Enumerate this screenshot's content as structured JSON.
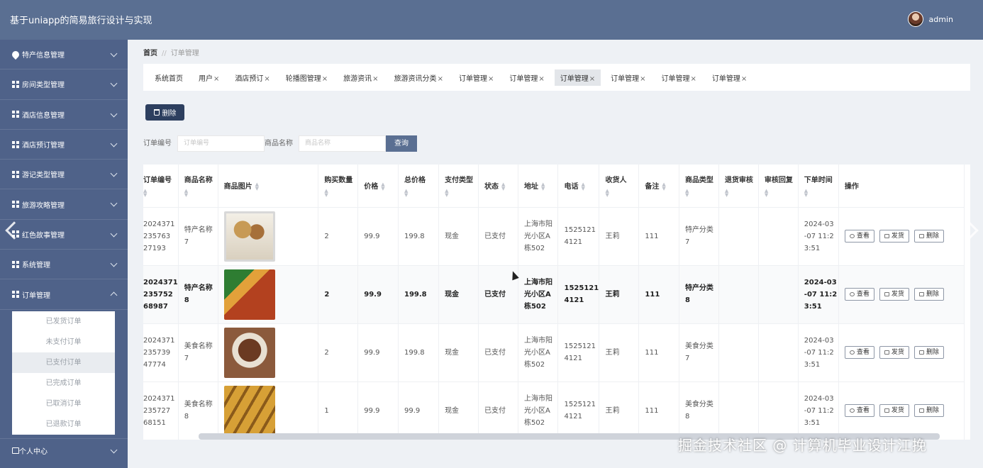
{
  "header": {
    "app_title": "基于uniapp的简易旅行设计与实现",
    "username": "admin"
  },
  "sidebar": {
    "items": [
      {
        "label": "特产信息管理",
        "icon": "pin-icon"
      },
      {
        "label": "房间类型管理",
        "icon": "grid-icon"
      },
      {
        "label": "酒店信息管理",
        "icon": "grid-icon"
      },
      {
        "label": "酒店预订管理",
        "icon": "grid-icon"
      },
      {
        "label": "游记类型管理",
        "icon": "grid-icon"
      },
      {
        "label": "旅游攻略管理",
        "icon": "grid-icon"
      },
      {
        "label": "红色故事管理",
        "icon": "grid-icon"
      },
      {
        "label": "系统管理",
        "icon": "grid-icon"
      },
      {
        "label": "订单管理",
        "icon": "grid-icon"
      }
    ],
    "submenu": [
      "已发货订单",
      "未支付订单",
      "已支付订单",
      "已完成订单",
      "已取消订单",
      "已退款订单"
    ],
    "bottom_item": "个人中心"
  },
  "breadcrumb": {
    "home": "首页",
    "separator": "//",
    "current": "订单管理"
  },
  "tabs": [
    {
      "label": "系统首页",
      "closable": false
    },
    {
      "label": "用户",
      "closable": true
    },
    {
      "label": "酒店预订",
      "closable": true
    },
    {
      "label": "轮播图管理",
      "closable": true
    },
    {
      "label": "旅游资讯",
      "closable": true
    },
    {
      "label": "旅游资讯分类",
      "closable": true
    },
    {
      "label": "订单管理",
      "closable": true
    },
    {
      "label": "订单管理",
      "closable": true
    },
    {
      "label": "订单管理",
      "closable": true,
      "active": true
    },
    {
      "label": "订单管理",
      "closable": true
    },
    {
      "label": "订单管理",
      "closable": true
    },
    {
      "label": "订单管理",
      "closable": true
    }
  ],
  "toolbar": {
    "delete_label": "删除"
  },
  "filters": {
    "order_no_label": "订单编号",
    "order_no_placeholder": "订单编号",
    "product_label": "商品名称",
    "product_placeholder": "商品名称",
    "query_label": "查询"
  },
  "table": {
    "columns": [
      "订单编号",
      "商品名称",
      "商品图片",
      "购买数量",
      "价格",
      "总价格",
      "支付类型",
      "状态",
      "地址",
      "电话",
      "收货人",
      "备注",
      "商品类型",
      "退货审核",
      "审核回复",
      "下单时间",
      "操作"
    ],
    "rows": [
      {
        "order_no": [
          "2024371",
          "235763",
          "27193"
        ],
        "name": [
          "特产名称",
          "7"
        ],
        "qty": "2",
        "price": "99.9",
        "total": "199.8",
        "pay": "现金",
        "status": "已支付",
        "addr": [
          "上海市阳",
          "光小区A",
          "栋502"
        ],
        "phone": [
          "1525121",
          "4121"
        ],
        "receiver": "王莉",
        "remark": "111",
        "type": [
          "特产分类",
          "7"
        ],
        "time": [
          "2024-03",
          "-07 11:2",
          "3:51"
        ]
      },
      {
        "order_no": [
          "2024371",
          "235752",
          "68987"
        ],
        "name": [
          "特产名称",
          "8"
        ],
        "qty": "2",
        "price": "99.9",
        "total": "199.8",
        "pay": "现金",
        "status": "已支付",
        "addr": [
          "上海市阳",
          "光小区A",
          "栋502"
        ],
        "phone": [
          "1525121",
          "4121"
        ],
        "receiver": "王莉",
        "remark": "111",
        "type": [
          "特产分类",
          "8"
        ],
        "time": [
          "2024-03",
          "-07 11:2",
          "3:51"
        ]
      },
      {
        "order_no": [
          "2024371",
          "235739",
          "47774"
        ],
        "name": [
          "美食名称",
          "7"
        ],
        "qty": "2",
        "price": "99.9",
        "total": "199.8",
        "pay": "现金",
        "status": "已支付",
        "addr": [
          "上海市阳",
          "光小区A",
          "栋502"
        ],
        "phone": [
          "1525121",
          "4121"
        ],
        "receiver": "王莉",
        "remark": "111",
        "type": [
          "美食分类",
          "7"
        ],
        "time": [
          "2024-03",
          "-07 11:2",
          "3:51"
        ]
      },
      {
        "order_no": [
          "2024371",
          "235727",
          "68151"
        ],
        "name": [
          "美食名称",
          "8"
        ],
        "qty": "1",
        "price": "99.9",
        "total": "99.9",
        "pay": "现金",
        "status": "已支付",
        "addr": [
          "上海市阳",
          "光小区A",
          "栋502"
        ],
        "phone": [
          "1525121",
          "4121"
        ],
        "receiver": "王莉",
        "remark": "111",
        "type": [
          "美食分类",
          "8"
        ],
        "time": [
          "2024-03",
          "-07 11:2",
          "3:51"
        ]
      }
    ],
    "actions": {
      "view": "查看",
      "ship": "发货",
      "delete": "删除"
    }
  },
  "watermark": "掘金技术社区 @ 计算机毕业设计江挽"
}
